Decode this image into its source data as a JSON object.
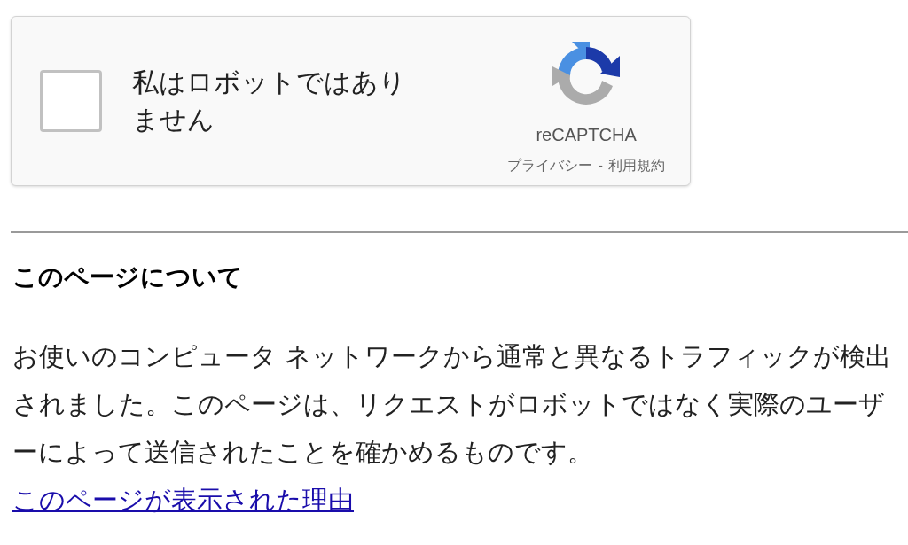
{
  "captcha": {
    "checkbox": {
      "label": "私はロボットではありません",
      "checked": false
    },
    "brand": "reCAPTCHA",
    "links": [
      "プライバシー",
      "利用規約"
    ],
    "separator": "-"
  },
  "about": {
    "heading": "このページについて",
    "text": "お使いのコンピュータ ネットワークから通常と異なるトラフィックが検出されました。このページは、リクエストがロボットではなく実際のユーザーによって送信されたことを確かめるものです。",
    "link": "このページが表示された理由"
  }
}
